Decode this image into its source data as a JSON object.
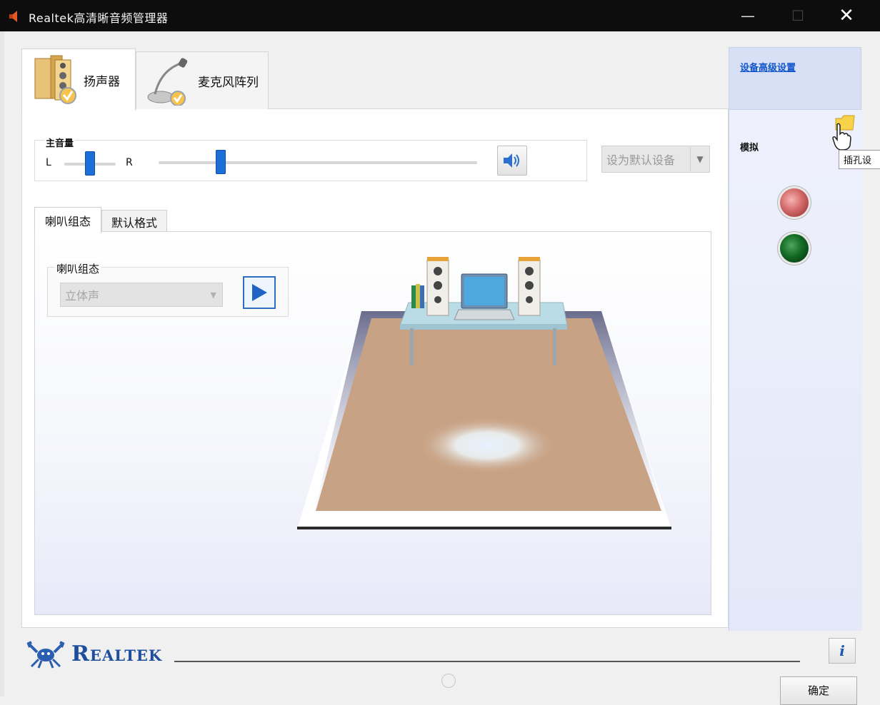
{
  "window": {
    "title": "Realtek高清晰音频管理器",
    "controls": {
      "minimize": "—",
      "maximize": "☐",
      "close": "✕"
    }
  },
  "device_tabs": [
    {
      "label": "扬声器",
      "icon": "speaker-icon",
      "selected": true
    },
    {
      "label": "麦克风阵列",
      "icon": "microphone-icon",
      "selected": false
    }
  ],
  "volume": {
    "title": "主音量",
    "left_label": "L",
    "right_label": "R",
    "balance_level": 0.5,
    "master_level": 0.18,
    "mute_icon": "speaker-volume-icon"
  },
  "default_device": {
    "label": "设为默认设备",
    "enabled": false
  },
  "sub_tabs": [
    {
      "label": "喇叭组态",
      "selected": true
    },
    {
      "label": "默认格式",
      "selected": false
    }
  ],
  "speaker_config": {
    "group_title": "喇叭组态",
    "selected": "立体声",
    "enabled": false,
    "play_icon": "play-icon"
  },
  "sidebar": {
    "link": "设备高级设置",
    "section_label": "模拟",
    "tooltip": "插孔设",
    "jacks": [
      {
        "color": "#d46a6a",
        "name": "pink-jack"
      },
      {
        "color": "#136b24",
        "name": "green-jack"
      }
    ]
  },
  "footer": {
    "brand": "Realtek",
    "info_label": "i",
    "ok_label": "确定"
  },
  "colors": {
    "titlebar": "#0d0d0d",
    "accent_blue": "#1b6fd6",
    "sidebar_bg": "#d8e0f6",
    "link": "#1155cc",
    "carpet": "#c8a284"
  }
}
